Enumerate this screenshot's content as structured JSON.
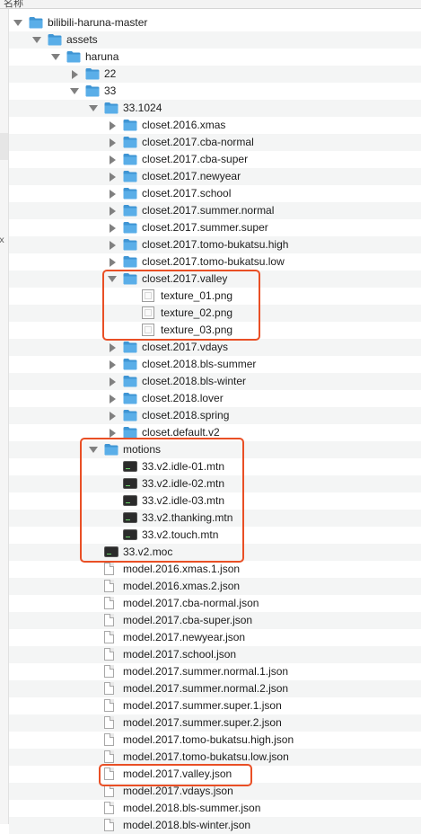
{
  "header": {
    "column_name": "名称"
  },
  "sidebar": {
    "glyph": "ⅹ"
  },
  "tree": [
    {
      "label": "bilibili-haruna-master",
      "kind": "folder",
      "depth": 0,
      "expanded": true
    },
    {
      "label": "assets",
      "kind": "folder",
      "depth": 1,
      "expanded": true
    },
    {
      "label": "haruna",
      "kind": "folder",
      "depth": 2,
      "expanded": true
    },
    {
      "label": "22",
      "kind": "folder",
      "depth": 3,
      "expanded": false
    },
    {
      "label": "33",
      "kind": "folder",
      "depth": 3,
      "expanded": true
    },
    {
      "label": "33.1024",
      "kind": "folder",
      "depth": 4,
      "expanded": true
    },
    {
      "label": "closet.2016.xmas",
      "kind": "folder",
      "depth": 5,
      "expanded": false
    },
    {
      "label": "closet.2017.cba-normal",
      "kind": "folder",
      "depth": 5,
      "expanded": false
    },
    {
      "label": "closet.2017.cba-super",
      "kind": "folder",
      "depth": 5,
      "expanded": false
    },
    {
      "label": "closet.2017.newyear",
      "kind": "folder",
      "depth": 5,
      "expanded": false
    },
    {
      "label": "closet.2017.school",
      "kind": "folder",
      "depth": 5,
      "expanded": false
    },
    {
      "label": "closet.2017.summer.normal",
      "kind": "folder",
      "depth": 5,
      "expanded": false
    },
    {
      "label": "closet.2017.summer.super",
      "kind": "folder",
      "depth": 5,
      "expanded": false
    },
    {
      "label": "closet.2017.tomo-bukatsu.high",
      "kind": "folder",
      "depth": 5,
      "expanded": false
    },
    {
      "label": "closet.2017.tomo-bukatsu.low",
      "kind": "folder",
      "depth": 5,
      "expanded": false
    },
    {
      "label": "closet.2017.valley",
      "kind": "folder",
      "depth": 5,
      "expanded": true
    },
    {
      "label": "texture_01.png",
      "kind": "png",
      "depth": 6
    },
    {
      "label": "texture_02.png",
      "kind": "png",
      "depth": 6
    },
    {
      "label": "texture_03.png",
      "kind": "png",
      "depth": 6
    },
    {
      "label": "closet.2017.vdays",
      "kind": "folder",
      "depth": 5,
      "expanded": false
    },
    {
      "label": "closet.2018.bls-summer",
      "kind": "folder",
      "depth": 5,
      "expanded": false
    },
    {
      "label": "closet.2018.bls-winter",
      "kind": "folder",
      "depth": 5,
      "expanded": false
    },
    {
      "label": "closet.2018.lover",
      "kind": "folder",
      "depth": 5,
      "expanded": false
    },
    {
      "label": "closet.2018.spring",
      "kind": "folder",
      "depth": 5,
      "expanded": false
    },
    {
      "label": "closet.default.v2",
      "kind": "folder",
      "depth": 5,
      "expanded": false
    },
    {
      "label": "motions",
      "kind": "folder",
      "depth": 4,
      "expanded": true
    },
    {
      "label": "33.v2.idle-01.mtn",
      "kind": "exec",
      "depth": 5
    },
    {
      "label": "33.v2.idle-02.mtn",
      "kind": "exec",
      "depth": 5
    },
    {
      "label": "33.v2.idle-03.mtn",
      "kind": "exec",
      "depth": 5
    },
    {
      "label": "33.v2.thanking.mtn",
      "kind": "exec",
      "depth": 5
    },
    {
      "label": "33.v2.touch.mtn",
      "kind": "exec",
      "depth": 5
    },
    {
      "label": "33.v2.moc",
      "kind": "exec",
      "depth": 4
    },
    {
      "label": "model.2016.xmas.1.json",
      "kind": "file",
      "depth": 4
    },
    {
      "label": "model.2016.xmas.2.json",
      "kind": "file",
      "depth": 4
    },
    {
      "label": "model.2017.cba-normal.json",
      "kind": "file",
      "depth": 4
    },
    {
      "label": "model.2017.cba-super.json",
      "kind": "file",
      "depth": 4
    },
    {
      "label": "model.2017.newyear.json",
      "kind": "file",
      "depth": 4
    },
    {
      "label": "model.2017.school.json",
      "kind": "file",
      "depth": 4
    },
    {
      "label": "model.2017.summer.normal.1.json",
      "kind": "file",
      "depth": 4
    },
    {
      "label": "model.2017.summer.normal.2.json",
      "kind": "file",
      "depth": 4
    },
    {
      "label": "model.2017.summer.super.1.json",
      "kind": "file",
      "depth": 4
    },
    {
      "label": "model.2017.summer.super.2.json",
      "kind": "file",
      "depth": 4
    },
    {
      "label": "model.2017.tomo-bukatsu.high.json",
      "kind": "file",
      "depth": 4
    },
    {
      "label": "model.2017.tomo-bukatsu.low.json",
      "kind": "file",
      "depth": 4
    },
    {
      "label": "model.2017.valley.json",
      "kind": "file",
      "depth": 4
    },
    {
      "label": "model.2017.vdays.json",
      "kind": "file",
      "depth": 4
    },
    {
      "label": "model.2018.bls-summer.json",
      "kind": "file",
      "depth": 4
    },
    {
      "label": "model.2018.bls-winter.json",
      "kind": "file",
      "depth": 4
    }
  ],
  "colors": {
    "folder_body": "#5aaee8",
    "folder_tab": "#3f95d4",
    "highlight": "#e94f25",
    "alt_row": "#f4f5f5"
  }
}
